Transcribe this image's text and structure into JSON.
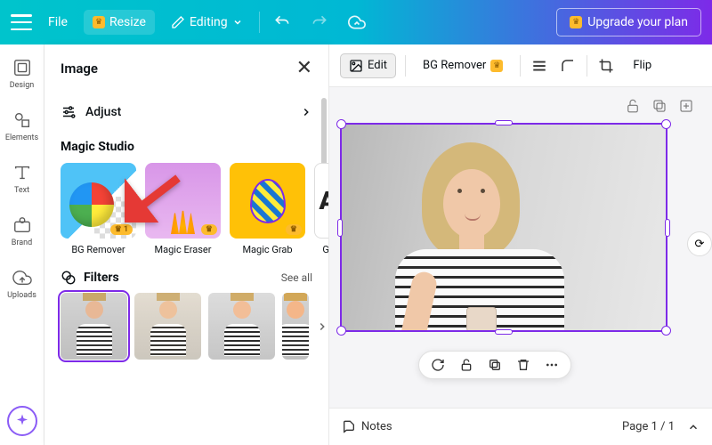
{
  "topbar": {
    "file": "File",
    "resize": "Resize",
    "editing": "Editing",
    "upgrade": "Upgrade your plan"
  },
  "sidebar": {
    "items": [
      {
        "label": "Design"
      },
      {
        "label": "Elements"
      },
      {
        "label": "Text"
      },
      {
        "label": "Brand"
      },
      {
        "label": "Uploads"
      }
    ]
  },
  "panel": {
    "title": "Image",
    "adjust": "Adjust",
    "magic_studio": "Magic Studio",
    "ms": [
      {
        "label": "BG Remover",
        "badge": "1"
      },
      {
        "label": "Magic Eraser",
        "badge": ""
      },
      {
        "label": "Magic Grab",
        "badge": ""
      },
      {
        "label": "Gr",
        "badge": ""
      }
    ],
    "filters": "Filters",
    "see_all": "See all"
  },
  "canvas_toolbar": {
    "edit": "Edit",
    "bg_remover": "BG Remover",
    "flip": "Flip"
  },
  "bottom": {
    "notes": "Notes",
    "page": "Page 1 / 1"
  }
}
